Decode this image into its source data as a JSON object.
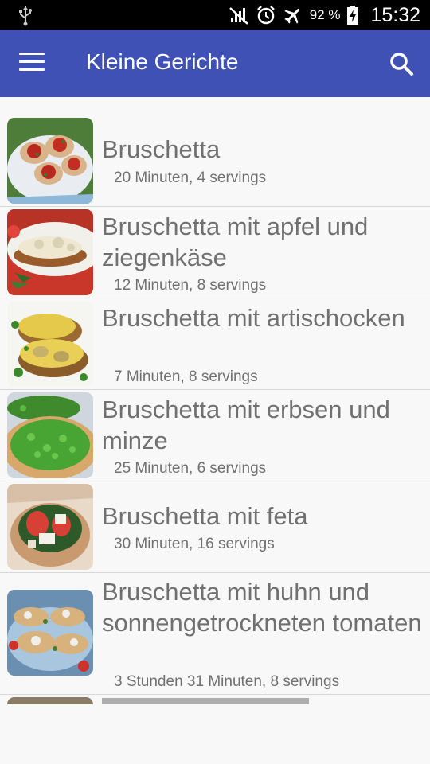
{
  "status_bar": {
    "battery_percent": "92 %",
    "time": "15:32",
    "icons": [
      "usb-icon",
      "no-signal-icon",
      "alarm-icon",
      "airplane-mode-icon",
      "battery-charging-icon"
    ]
  },
  "app_bar": {
    "title": "Kleine Gerichte",
    "menu_icon": "hamburger-menu-icon",
    "search_icon": "search-icon"
  },
  "recipes": [
    {
      "title": "Bruschetta",
      "subtitle": "20 Minuten, 4 servings"
    },
    {
      "title": "Bruschetta mit apfel und ziegenkäse",
      "subtitle": "12 Minuten, 8 servings"
    },
    {
      "title": "Bruschetta mit artischocken",
      "subtitle": "7 Minuten, 8 servings"
    },
    {
      "title": "Bruschetta mit erbsen und minze",
      "subtitle": "25 Minuten, 6 servings"
    },
    {
      "title": "Bruschetta mit feta",
      "subtitle": "30 Minuten, 16 servings"
    },
    {
      "title": "Bruschetta mit huhn und sonnengetrockneten tomaten",
      "subtitle": "3 Stunden 31 Minuten, 8 servings"
    }
  ],
  "colors": {
    "app_bar": "#3f51b5",
    "status_bar": "#000000",
    "background": "#f8f8f8",
    "text": "#707070"
  }
}
